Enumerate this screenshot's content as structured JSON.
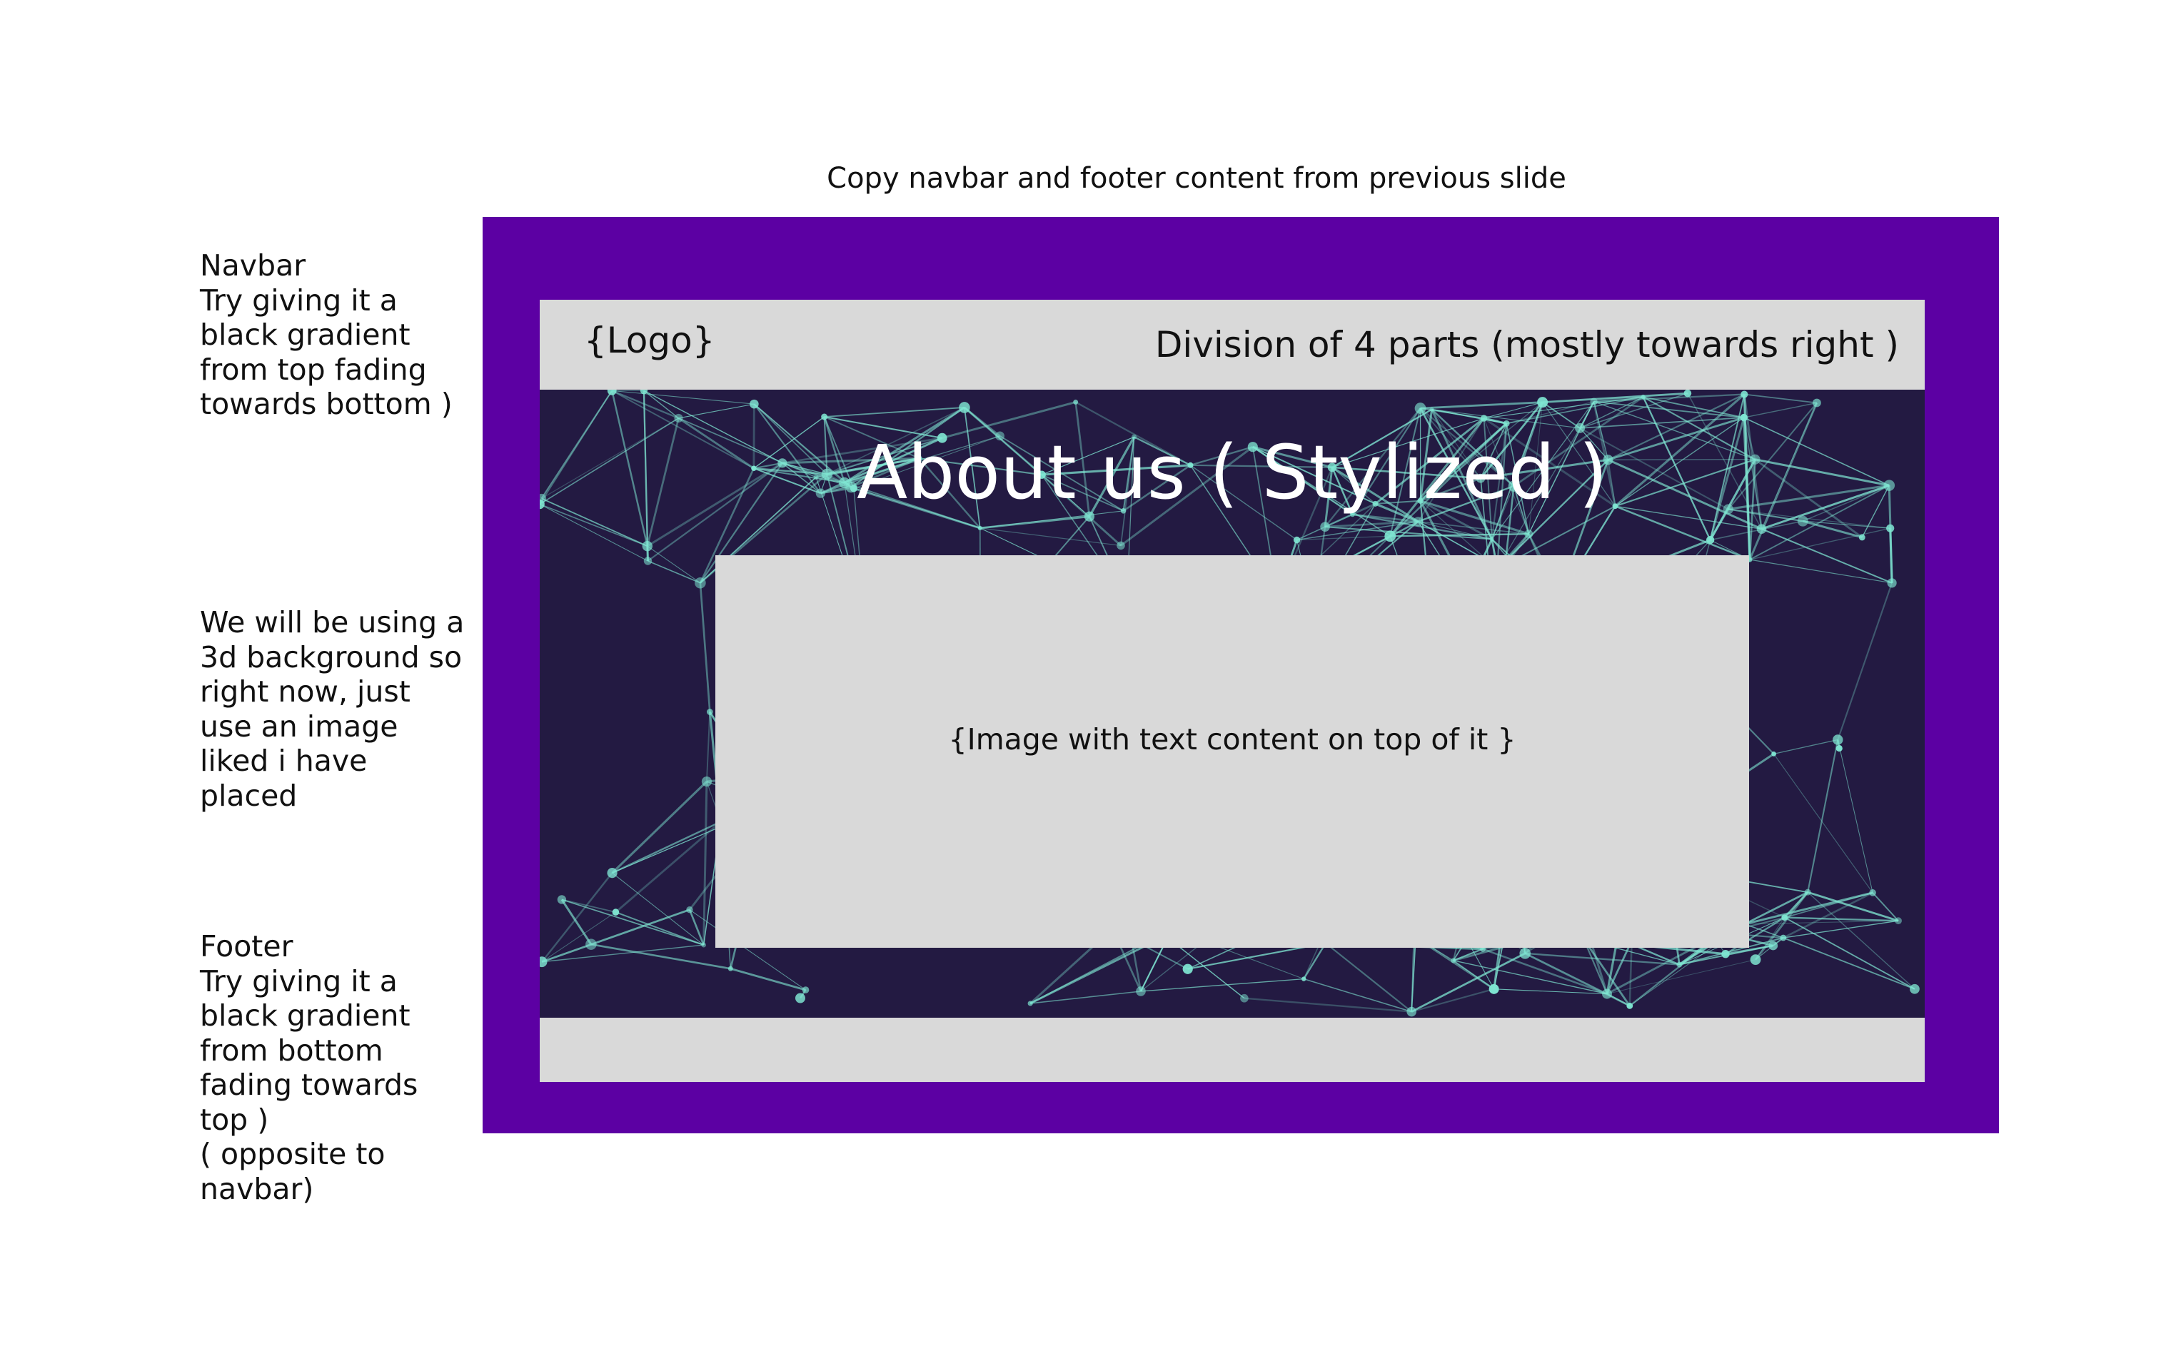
{
  "annotations": {
    "top_note": "Copy navbar and footer content from previous slide",
    "navbar_note": "Navbar\nTry giving it a black gradient from top fading towards bottom )",
    "background_note": "We will be using a 3d background so right now, just use an image liked i have placed",
    "footer_note": "Footer\nTry giving it a black gradient from bottom fading towards top )\n( opposite to navbar)"
  },
  "mockup": {
    "navbar": {
      "logo": "{Logo}",
      "links_placeholder": "Division of 4 parts (mostly towards right )"
    },
    "hero": {
      "title": "About us ( Stylized )",
      "background_image": "network-plexus-background"
    },
    "content": {
      "placeholder": "{Image with text content on top of it }"
    },
    "footer": {
      "placeholder": ""
    }
  },
  "colors": {
    "frame": "#5c00a3",
    "placeholder_gray": "#d9d9d9",
    "hero_background": "#231a42",
    "network_lines": "#7fe6d2"
  }
}
